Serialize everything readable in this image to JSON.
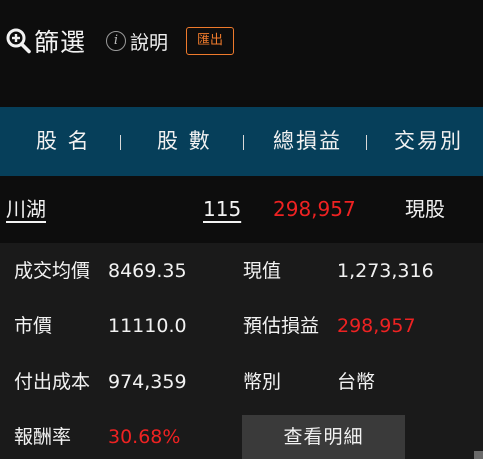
{
  "toolbar": {
    "filter_icon": "zoom-plus-icon",
    "filter_label": "篩選",
    "help_icon": "info-icon",
    "help_icon_glyph": "i",
    "help_label": "說明",
    "export_label": "匯出"
  },
  "table": {
    "headers": [
      "股 名",
      "股 數",
      "總損益",
      "交易別"
    ],
    "row": {
      "name": "川湖",
      "shares": "115",
      "profit": "298,957",
      "trade_type": "現股"
    }
  },
  "detail": {
    "avg_cost_label": "成交均價",
    "avg_cost_value": "8469.35",
    "current_label": "現值",
    "current_value": "1,273,316",
    "market_price_label": "市價",
    "market_price_value": "11110.0",
    "est_profit_label": "預估損益",
    "est_profit_value": "298,957",
    "cost_label": "付出成本",
    "cost_value": "974,359",
    "currency_label": "幣別",
    "currency_value": "台幣",
    "return_label": "報酬率",
    "return_value": "30.68%",
    "view_details_label": "查看明細"
  },
  "colors": {
    "background": "#0d0d0d",
    "header_bg": "#063f5a",
    "panel_bg": "#1a1a1a",
    "accent_orange": "#ee7a2c",
    "profit_red": "#ee2222",
    "button_bg": "#3a3a3a"
  }
}
